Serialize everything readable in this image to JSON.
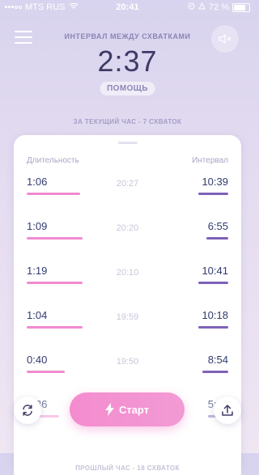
{
  "status_bar": {
    "carrier": "MTS RUS",
    "time": "20:41",
    "battery": "72 %"
  },
  "header": {
    "interval_title": "ИНТЕРВАЛ МЕЖДУ СХВАТКАМИ",
    "interval_value": "2:37",
    "help_label": "ПОМОЩЬ",
    "hour_summary": "ЗА ТЕКУЩИЙ ЧАС - 7 СХВАТОК"
  },
  "table": {
    "col_duration": "Длительность",
    "col_interval": "Интервал",
    "rows": [
      {
        "duration": "1:06",
        "start": "20:27",
        "interval": "10:39",
        "duration_frac": 0.66,
        "interval_frac": 0.3
      },
      {
        "duration": "1:09",
        "start": "20:20",
        "interval": "6:55",
        "duration_frac": 0.69,
        "interval_frac": 0.2
      },
      {
        "duration": "1:19",
        "start": "20:10",
        "interval": "10:41",
        "duration_frac": 0.69,
        "interval_frac": 0.3
      },
      {
        "duration": "1:04",
        "start": "19:59",
        "interval": "10:18",
        "duration_frac": 0.69,
        "interval_frac": 0.3
      },
      {
        "duration": "0:40",
        "start": "19:50",
        "interval": "8:54",
        "duration_frac": 0.47,
        "interval_frac": 0.25
      },
      {
        "duration": "0:36",
        "start": "",
        "interval": "5:12",
        "duration_frac": 0.4,
        "interval_frac": 0.18
      }
    ],
    "prev_hour_summary": "ПРОШЛЫЙ ЧАС - 18 СХВАТОК"
  },
  "actions": {
    "start_label": "Старт"
  },
  "colors": {
    "duration_bar": "#f28ad0",
    "interval_bar": "#7d62b8",
    "accent_pink": "#f48ccf"
  }
}
